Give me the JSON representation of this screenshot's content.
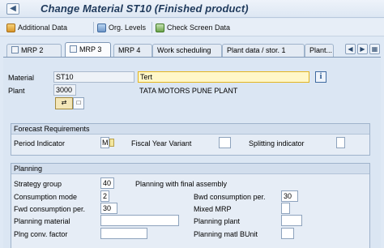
{
  "window": {
    "title": "Change Material ST10 (Finished product)"
  },
  "toolbar": {
    "additional_data": "Additional Data",
    "org_levels": "Org. Levels",
    "check_screen_data": "Check Screen Data"
  },
  "tabs": [
    "MRP 2",
    "MRP 3",
    "MRP 4",
    "Work scheduling",
    "Plant data / stor. 1",
    "Plant..."
  ],
  "header": {
    "material_label": "Material",
    "material_value": "ST10",
    "material_desc": "Tert",
    "plant_label": "Plant",
    "plant_value": "3000",
    "plant_desc": "TATA MOTORS PUNE PLANT"
  },
  "forecast": {
    "title": "Forecast Requirements",
    "period_indicator_label": "Period Indicator",
    "period_indicator_value": "M",
    "fiscal_year_variant_label": "Fiscal Year Variant",
    "fiscal_year_variant_value": "",
    "splitting_indicator_label": "Splitting indicator",
    "splitting_indicator_value": ""
  },
  "planning": {
    "title": "Planning",
    "strategy_group_label": "Strategy group",
    "strategy_group_value": "40",
    "strategy_group_desc": "Planning with final assembly",
    "consumption_mode_label": "Consumption mode",
    "consumption_mode_value": "2",
    "bwd_consumption_label": "Bwd consumption per.",
    "bwd_consumption_value": "30",
    "fwd_consumption_label": "Fwd consumption per.",
    "fwd_consumption_value": "30",
    "mixed_mrp_label": "Mixed MRP",
    "mixed_mrp_value": "",
    "planning_material_label": "Planning material",
    "planning_material_value": "",
    "planning_plant_label": "Planning plant",
    "planning_plant_value": "",
    "plng_conv_factor_label": "Plng conv. factor",
    "plng_conv_factor_value": "",
    "planning_matl_bunit_label": "Planning matl BUnit",
    "planning_matl_bunit_value": ""
  }
}
